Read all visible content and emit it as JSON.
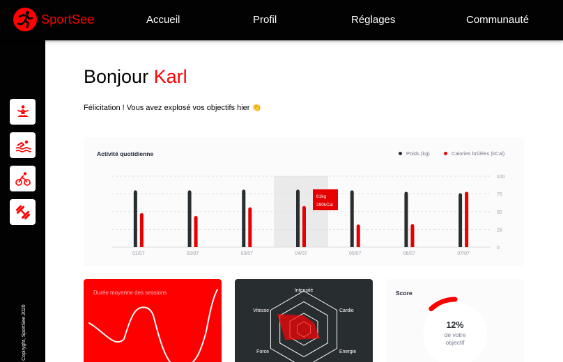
{
  "brand": {
    "name": "SportSee",
    "accent": "#ff0101",
    "logo_icon": "runner-icon"
  },
  "nav": [
    "Accueil",
    "Profil",
    "Réglages",
    "Communauté"
  ],
  "sidebar": {
    "icons": [
      "yoga-icon",
      "swimming-icon",
      "cycling-icon",
      "dumbbell-icon"
    ],
    "copyright": "Copiryght, SportSee 2020"
  },
  "greeting": {
    "prefix": "Bonjour",
    "user": "Karl"
  },
  "congrats": "Félicitation ! Vous avez explosé vos objectifs hier 👏",
  "activity": {
    "title": "Activité quotidienne",
    "legend": [
      "Poids (kg)",
      "Calories brûlées (kCal)"
    ],
    "tooltip": [
      "81kg",
      "290kCal"
    ]
  },
  "sessions": {
    "title": "Durée moyenne des sessions"
  },
  "performance": {
    "labels": [
      "Intensité",
      "Cardio",
      "Energie",
      "Vitesse",
      "Force"
    ]
  },
  "score": {
    "title": "Score",
    "value": "12%",
    "caption_line1": "de votre",
    "caption_line2": "objectif"
  },
  "chart_data": [
    {
      "type": "bar",
      "title": "Activité quotidienne",
      "categories": [
        "01/07",
        "02/07",
        "03/07",
        "04/07",
        "05/07",
        "06/07",
        "07/07"
      ],
      "series": [
        {
          "name": "Poids (kg)",
          "values": [
            80,
            80,
            81,
            81,
            80,
            78,
            76
          ],
          "color": "#282d30"
        },
        {
          "name": "Calories brûlées (kCal)",
          "values": [
            240,
            220,
            280,
            290,
            160,
            162,
            390
          ],
          "color": "#e60000"
        }
      ],
      "y_ticks": [
        0,
        25,
        50,
        75,
        100
      ],
      "ylim": [
        0,
        100
      ],
      "highlighted_category": "04/07",
      "legend_position": "top-right",
      "grid": true
    },
    {
      "type": "line",
      "title": "Durée moyenne des sessions",
      "x": [
        1,
        2,
        3,
        4,
        5,
        6,
        7
      ],
      "values": [
        30,
        23,
        45,
        50,
        0,
        0,
        60
      ]
    },
    {
      "type": "radar",
      "categories": [
        "Intensité",
        "Cardio",
        "Energie",
        "Force",
        "Vitesse"
      ],
      "values": [
        90,
        80,
        120,
        140,
        200
      ],
      "rmax": 250
    },
    {
      "type": "pie",
      "title": "Score",
      "values": [
        0.12
      ],
      "color": "#ff0000"
    }
  ]
}
